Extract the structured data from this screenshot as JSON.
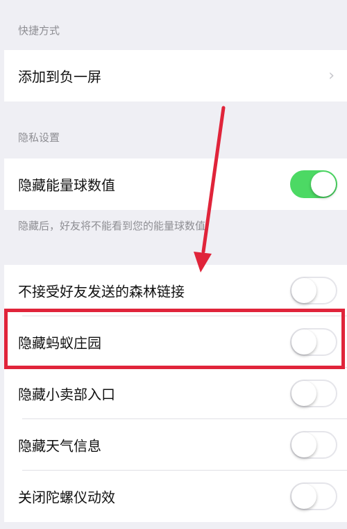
{
  "shortcuts": {
    "header": "快捷方式",
    "add_to_negative_screen": "添加到负一屏"
  },
  "privacy": {
    "header": "隐私设置",
    "hide_energy_ball": {
      "label": "隐藏能量球数值",
      "on": true
    },
    "footnote": "隐藏后，好友将不能看到您的能量球数值"
  },
  "settings": [
    {
      "label": "不接受好友发送的森林链接",
      "on": false
    },
    {
      "label": "隐藏蚂蚁庄园",
      "on": false
    },
    {
      "label": "隐藏小卖部入口",
      "on": false
    },
    {
      "label": "隐藏天气信息",
      "on": false
    },
    {
      "label": "关闭陀螺仪动效",
      "on": false
    }
  ],
  "colors": {
    "toggle_on": "#4cd964",
    "annotation_red": "#e0243a"
  },
  "icons": {
    "chevron": "chevron-right-icon"
  }
}
